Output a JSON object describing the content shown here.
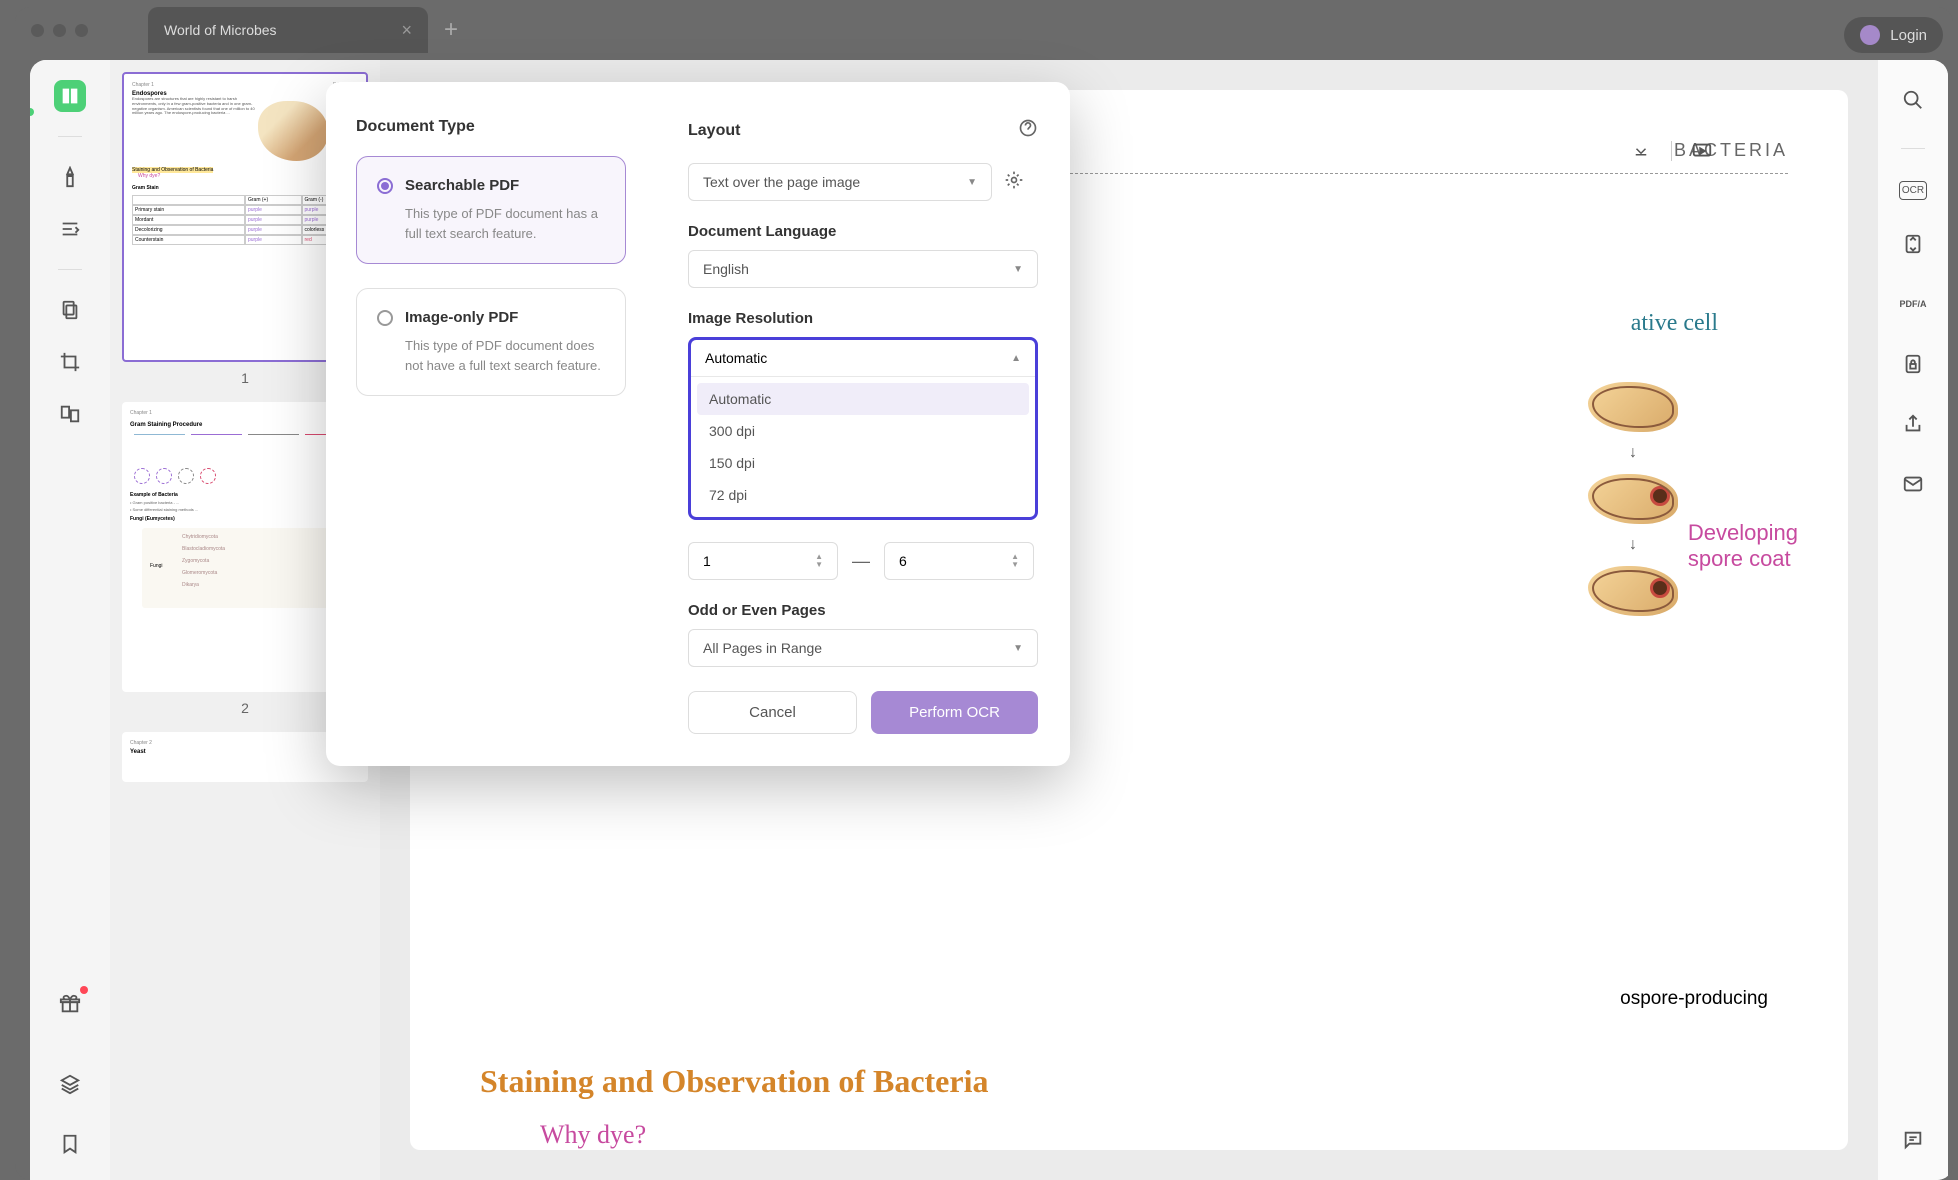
{
  "window": {
    "tab_title": "World of Microbes",
    "login_label": "Login"
  },
  "thumbnails": {
    "page1_label": "1",
    "page2_label": "2",
    "page1_chapter": "Chapter 1",
    "page1_tag": "BACTERIA",
    "heading1": "Endospores",
    "body_snippet": "Endospores are structures that are highly resistant to harsh environments, only in a few gram-positive bacteria and in one gram-negative organism. American scientists found that one of million to 40 million years ago. The endospore-producing bacteria ...",
    "staining_line": "Staining and Observation of Bacteria",
    "why_dye": "Why dye?",
    "gram_stain": "Gram Stain",
    "page2_heading": "Gram Staining Procedure",
    "example_heading": "Example of Bacteria",
    "fungi_heading": "Fungi (Eumycetes)"
  },
  "document": {
    "header_right": "BACTERIA",
    "vegetative_label": "ative cell",
    "spore_label1": "Developing",
    "spore_label2": "spore coat",
    "bottom_text": "ospore-producing",
    "staining_heading": "Staining and Observation of Bacteria",
    "why_dye": "Why dye?"
  },
  "modal": {
    "doc_type_heading": "Document Type",
    "type1_title": "Searchable PDF",
    "type1_desc": "This type of PDF document has a full text search feature.",
    "type2_title": "Image-only PDF",
    "type2_desc": "This type of PDF document does not have a full text search feature.",
    "layout_heading": "Layout",
    "layout_value": "Text over the page image",
    "language_heading": "Document Language",
    "language_value": "English",
    "resolution_heading": "Image Resolution",
    "resolution_selected": "Automatic",
    "resolution_options": [
      "Automatic",
      "300 dpi",
      "150 dpi",
      "72 dpi"
    ],
    "page_from": "1",
    "page_to": "6",
    "odd_even_heading": "Odd or Even Pages",
    "odd_even_value": "All Pages in Range",
    "cancel_label": "Cancel",
    "perform_label": "Perform OCR"
  }
}
